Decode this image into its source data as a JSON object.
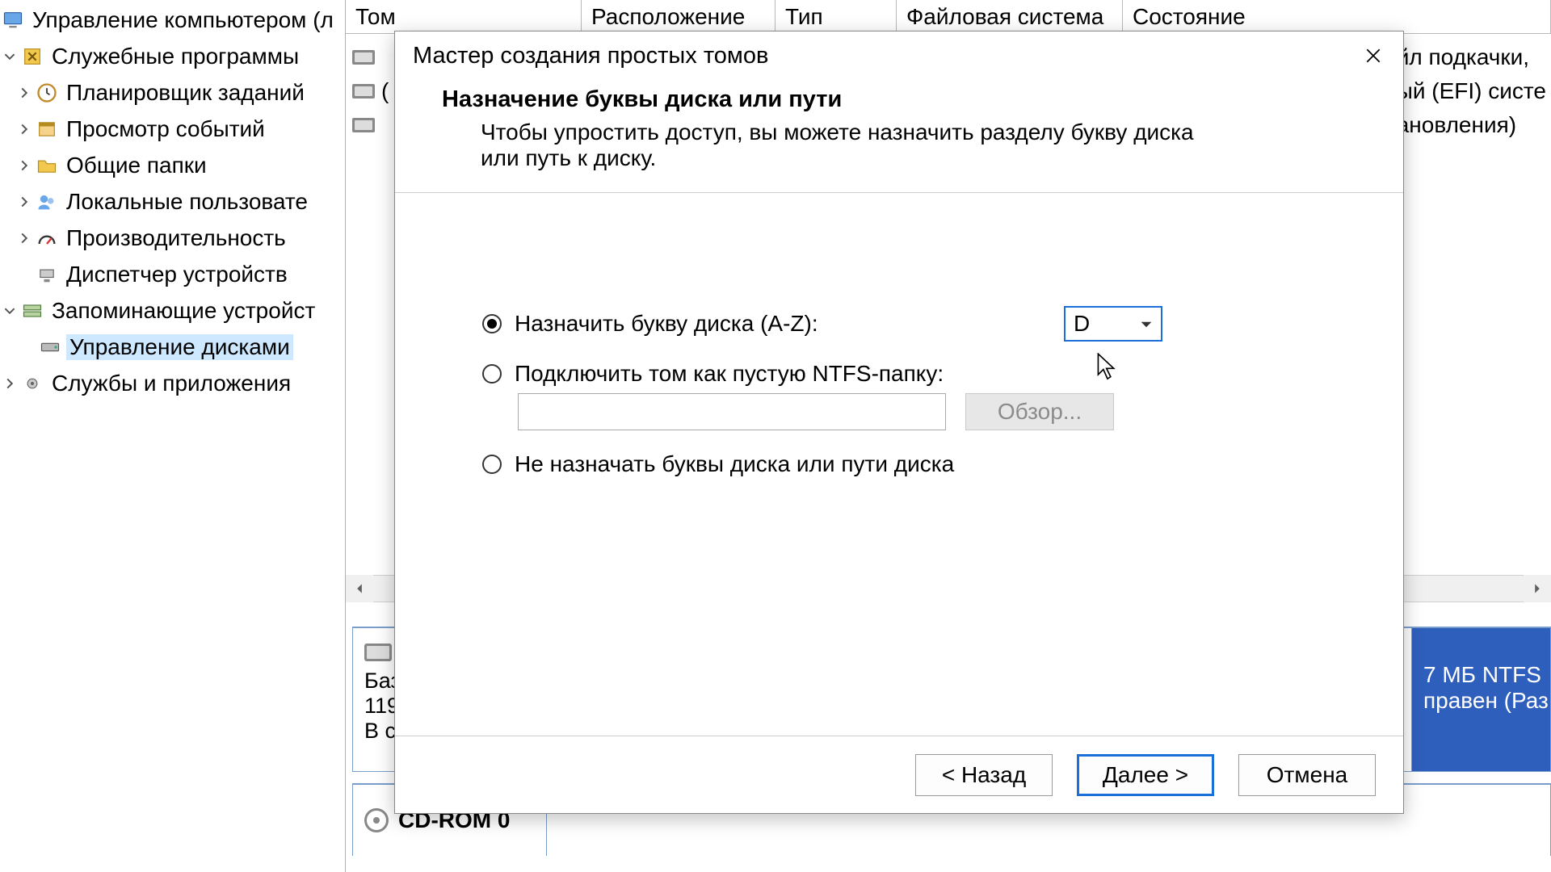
{
  "tree": {
    "root": "Управление компьютером (л",
    "utilNode": "Служебные программы",
    "items": {
      "sched": "Планировщик заданий",
      "events": "Просмотр событий",
      "shared": "Общие папки",
      "users": "Локальные пользовате",
      "perf": "Производительность",
      "devmgr": "Диспетчер устройств"
    },
    "storageNode": "Запоминающие устройст",
    "diskmgmt": "Управление дисками",
    "services": "Службы и приложения"
  },
  "columns": {
    "c0": "Том",
    "c1": "Расположение",
    "c2": "Тип",
    "c3": "Файловая система",
    "c4": "Состояние"
  },
  "slivers": {
    "s1": "йл подкачки,",
    "s2": "ый (EFI) систе",
    "s3": "ановления)"
  },
  "vol": {
    "paren": "("
  },
  "disk0": {
    "type": "Баз",
    "size": "119",
    "state": "В с",
    "part_sel_l1": "7 МБ NTFS",
    "part_sel_l2": "правен (Раз"
  },
  "cd": {
    "title": "CD-ROM 0"
  },
  "wizard": {
    "title": "Мастер создания простых томов",
    "heading": "Назначение буквы диска или пути",
    "sub": "Чтобы упростить доступ, вы можете назначить разделу букву диска или путь к диску.",
    "opt1": "Назначить букву диска (A-Z):",
    "letter": "D",
    "opt2": "Подключить том как пустую NTFS-папку:",
    "browse": "Обзор...",
    "opt3": "Не назначать буквы диска или пути диска",
    "back": "< Назад",
    "next": "Далее >",
    "cancel": "Отмена"
  }
}
